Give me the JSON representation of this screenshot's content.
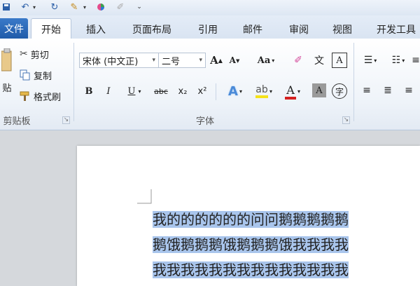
{
  "tabs": {
    "file": "文件",
    "items": [
      "开始",
      "插入",
      "页面布局",
      "引用",
      "邮件",
      "审阅",
      "视图",
      "开发工具"
    ]
  },
  "clipboard": {
    "paste_label": "贴",
    "cut": "剪切",
    "copy": "复制",
    "format_painter": "格式刷",
    "group_label": "剪贴板"
  },
  "font": {
    "font_name": "宋体 (中文正)",
    "font_size": "二号",
    "bold": "B",
    "italic": "I",
    "underline": "U",
    "strike": "abc",
    "subscript": "x₂",
    "superscript": "x²",
    "case_label": "Aa",
    "border_char": "A",
    "shade_char": "A",
    "circle_char": "字",
    "phonetic_char": "文",
    "group_label": "字体"
  },
  "document": {
    "lines": [
      "我的的的的的的问问鹅鹅鹅鹅鹅",
      "鹅饿鹅鹅鹅饿鹅鹅鹅饿我我我我",
      "我我我我我我我我我我我我我我"
    ]
  },
  "colors": {
    "file_tab": "#2a66b6",
    "selection": "#a9c5ec",
    "highlight_yellow": "#f5e21a",
    "font_red": "#d42020"
  }
}
